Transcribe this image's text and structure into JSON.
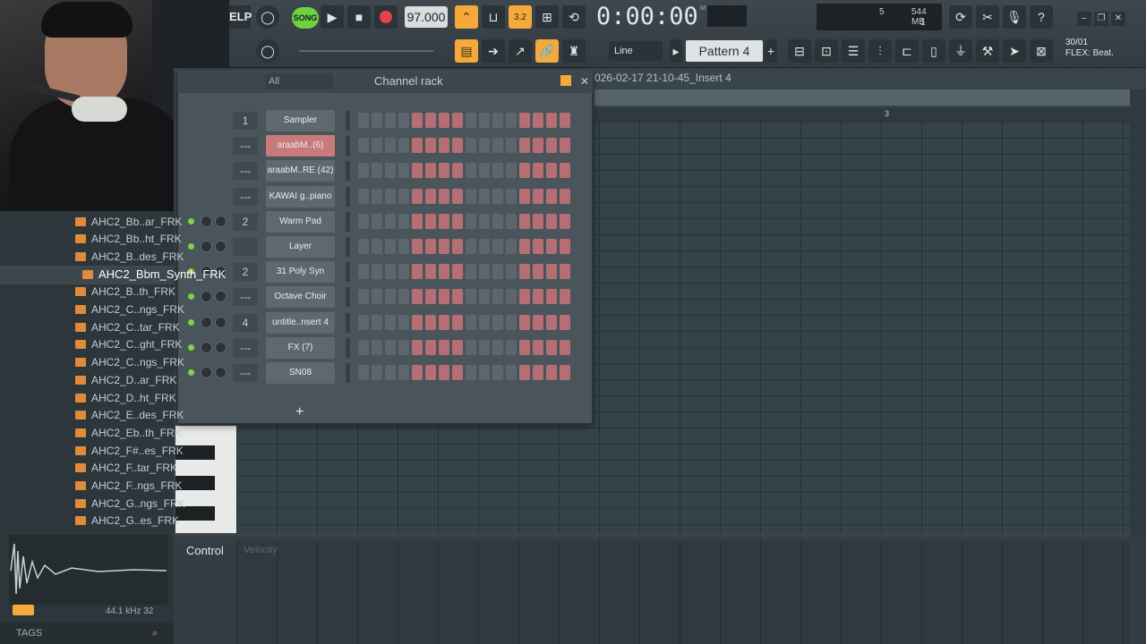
{
  "toolbar": {
    "elp": "ELP",
    "song_mode": "SONG",
    "tempo": "97.000",
    "time": "0:00:00",
    "time_unit": "M:S:CS",
    "cpu_value": "5",
    "memory": "544 MB",
    "polyphony": "1",
    "snap": "Line",
    "pattern": "Pattern 4",
    "flex_date": "30/01",
    "flex_label": "FLEX: Beat."
  },
  "browser": {
    "items": [
      "AHC2_Bb..ar_FRK",
      "AHC2_Bb..ht_FRK",
      "AHC2_B..des_FRK",
      "AHC2_Bbm_Synth_FRK",
      "AHC2_B..th_FRK",
      "AHC2_C..ngs_FRK",
      "AHC2_C..tar_FRK",
      "AHC2_C..ght_FRK",
      "AHC2_C..ngs_FRK",
      "AHC2_D..ar_FRK",
      "AHC2_D..ht_FRK",
      "AHC2_E..des_FRK",
      "AHC2_Eb..th_FRK",
      "AHC2_F#..es_FRK",
      "AHC2_F..tar_FRK",
      "AHC2_F..ngs_FRK",
      "AHC2_G..ngs_FRK",
      "AHC2_G..es_FRK"
    ],
    "selected_index": 3,
    "sample_info": "44.1 kHz 32",
    "tags_label": "TAGS"
  },
  "pianoroll": {
    "title": "026-02-17 21-10-45_Insert 4",
    "ruler_marker": "3",
    "control_label": "Control",
    "control_target": "Velocity"
  },
  "rack": {
    "filter": "All",
    "title": "Channel rack",
    "channels": [
      {
        "route": "1",
        "name": "Sampler",
        "leds": false
      },
      {
        "route": "---",
        "name": "araabM..(6)",
        "leds": false,
        "active": true
      },
      {
        "route": "---",
        "name": "araabM..RE (42)",
        "leds": false
      },
      {
        "route": "---",
        "name": "KAWAI g..piano",
        "leds": false
      },
      {
        "route": "2",
        "name": "Warm Pad",
        "leds": true
      },
      {
        "route": "",
        "name": "Layer",
        "leds": true
      },
      {
        "route": "2",
        "name": "31 Poly Syn",
        "leds": true
      },
      {
        "route": "---",
        "name": "Octave Choir",
        "leds": true
      },
      {
        "route": "4",
        "name": "untitle..nsert 4",
        "leds": true
      },
      {
        "route": "---",
        "name": "FX (7)",
        "leds": true
      },
      {
        "route": "---",
        "name": "SN08",
        "leds": true
      }
    ],
    "add_label": "+"
  }
}
